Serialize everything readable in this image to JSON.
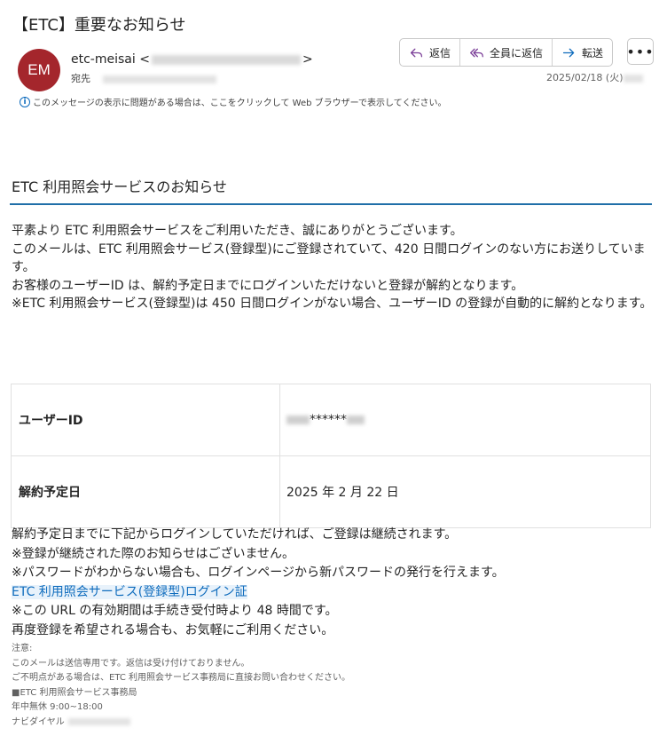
{
  "email": {
    "subject": "【ETC】重要なお知らせ",
    "avatar_initials": "EM",
    "avatar_color": "#a4262c",
    "sender_name": "etc-meisai <",
    "sender_suffix": ">",
    "to_label": "宛先",
    "date": "2025/02/18 (火)",
    "info_bar": "このメッセージの表示に問題がある場合は、ここをクリックして Web ブラウザーで表示してください。"
  },
  "toolbar": {
    "reply": "返信",
    "reply_all": "全員に返信",
    "forward": "転送",
    "more": "•••"
  },
  "body": {
    "heading": "ETC 利用照会サービスのお知らせ",
    "accent_color": "#1f6fa8",
    "paragraphs": [
      "平素より ETC 利用照会サービスをご利用いただき、誠にありがとうございます。",
      "このメールは、ETC 利用照会サービス(登録型)にご登録されていて、420 日間ログインのない方にお送りしています。",
      "お客様のユーザーID は、解約予定日までにログインいただけないと登録が解約となります。",
      "※ETC 利用照会サービス(登録型)は 450 日間ログインがない場合、ユーザーID の登録が自動的に解約となります。"
    ],
    "table": {
      "user_id_label": "ユーザーID",
      "user_id_value": "******",
      "cancel_date_label": "解約予定日",
      "cancel_date_value": "2025 年 2 月 22 日"
    },
    "after": {
      "line1": "解約予定日までに下記からログインしていただければ、ご登録は継続されます。",
      "line2": "※登録が継続された際のお知らせはございません。",
      "line3": "※パスワードがわからない場合も、ログインページから新パスワードの発行を行えます。",
      "link": "ETC 利用照会サービス(登録型)ログイン証",
      "line4": "※この URL の有効期間は手続き受付時より 48 時間です。",
      "line5": "再度登録を希望される場合も、お気軽にご利用ください。"
    },
    "notes": {
      "n1": "注意:",
      "n2": "このメールは送信専用です。返信は受け付けておりません。",
      "n3": "ご不明点がある場合は、ETC 利用照会サービス事務局に直接お問い合わせください。",
      "n4": "■ETC 利用照会サービス事務局",
      "n5": "年中無休 9:00~18:00",
      "n6": "ナビダイヤル"
    }
  }
}
